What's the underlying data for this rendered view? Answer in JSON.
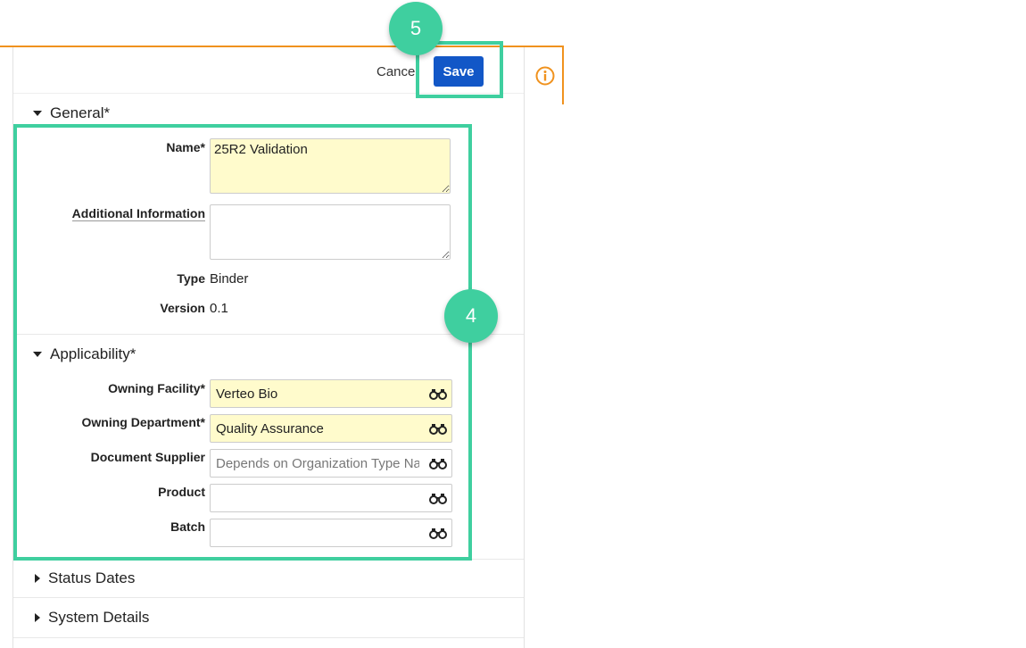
{
  "toolbar": {
    "cancel_label": "Cancel",
    "save_label": "Save"
  },
  "icons": {
    "info": "info-circle-icon",
    "lookup": "binoculars-icon"
  },
  "general": {
    "heading": "General*",
    "name_label": "Name*",
    "name_value": "25R2 Validation",
    "additional_info_label": "Additional Information",
    "additional_info_value": "",
    "type_label": "Type",
    "type_value": "Binder",
    "version_label": "Version",
    "version_value": "0.1"
  },
  "applicability": {
    "heading": "Applicability*",
    "owning_facility_label": "Owning Facility*",
    "owning_facility_value": "Verteo Bio",
    "owning_department_label": "Owning Department*",
    "owning_department_value": "Quality Assurance",
    "document_supplier_label": "Document Supplier",
    "document_supplier_placeholder": "Depends on Organization Type Name",
    "product_label": "Product",
    "product_value": "",
    "batch_label": "Batch",
    "batch_value": ""
  },
  "sections": {
    "status_dates": "Status Dates",
    "system_details": "System Details"
  },
  "callouts": {
    "step4": "4",
    "step5": "5"
  },
  "colors": {
    "accent": "#3fcf9f",
    "primary_button": "#1257c7",
    "border_top": "#f0921e",
    "required_field": "#fffbcc"
  }
}
